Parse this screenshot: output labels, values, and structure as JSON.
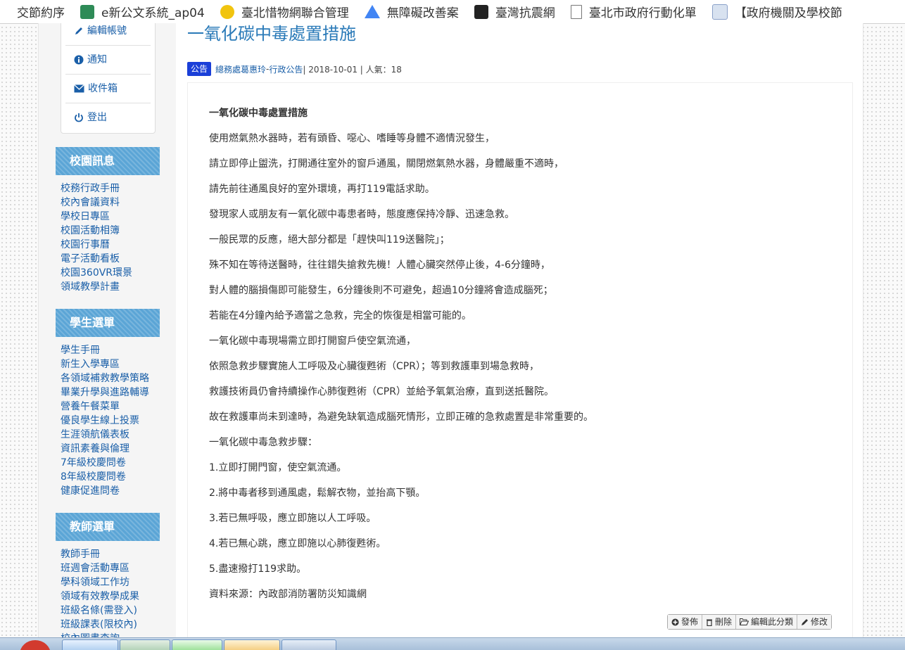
{
  "bookmarks": [
    {
      "label": "交節約序",
      "color": "#c0392b"
    },
    {
      "label": "e新公文系統_ap04",
      "color": "#2e8b57"
    },
    {
      "label": "臺北惜物網聯合管理",
      "color": "#f1c40f"
    },
    {
      "label": "無障礙改善案",
      "color": "#4285f4"
    },
    {
      "label": "臺灣抗震網",
      "color": "#222222"
    },
    {
      "label": "臺北市政府行動化單",
      "color": "#999999"
    },
    {
      "label": "【政府機關及學校節",
      "color": "#5b7bb5"
    }
  ],
  "user_menu": [
    {
      "label": "編輯帳號",
      "icon": "pencil-icon"
    },
    {
      "label": "通知",
      "icon": "info-icon"
    },
    {
      "label": "收件箱",
      "icon": "envelope-icon"
    },
    {
      "label": "登出",
      "icon": "power-icon"
    }
  ],
  "sections": [
    {
      "title": "校園訊息",
      "items": [
        "校務行政手冊",
        "校內會議資料",
        "學校日專區",
        "校園活動相簿",
        "校園行事曆",
        "電子活動看板",
        "校園360VR環景",
        "領域教學計畫"
      ]
    },
    {
      "title": "學生選單",
      "items": [
        "學生手冊",
        "新生入學專區",
        "各領域補救教學策略",
        "畢業升學與進路輔導",
        "營養午餐菜單",
        "優良學生線上投票",
        "生涯領航儀表板",
        "資訊素養與倫理",
        "7年級校慶問卷",
        "8年級校慶問卷",
        "健康促進問卷"
      ]
    },
    {
      "title": "教師選單",
      "items": [
        "教師手冊",
        "班週會活動專區",
        "學科領域工作坊",
        "領域有效教學成果",
        "班級名條(需登入)",
        "班級課表(限校內)",
        "校內圖書查詢"
      ]
    }
  ],
  "article": {
    "title": "一氧化碳中毒處置措施",
    "badge": "公告",
    "author": "總務處葛惠玲",
    "separator1": " - ",
    "category": "行政公告",
    "date_text": " | 2018-10-01 | 人氣：18",
    "paragraphs": [
      "一氧化碳中毒處置措施",
      "使用燃氣熱水器時，若有頭昏、噁心、嗜睡等身體不適情況發生，",
      "請立即停止盥洗，打開通往室外的窗戶通風，關閉燃氣熱水器，身體嚴重不適時，",
      "請先前往通風良好的室外環境，再打119電話求助。",
      "發現家人或朋友有一氧化碳中毒患者時，態度應保持冷靜、迅速急救。",
      "一般民眾的反應，絕大部分都是「趕快叫119送醫院」；",
      "殊不知在等待送醫時，往往錯失搶救先機！人體心臟突然停止後，4-6分鐘時，",
      "對人體的腦損傷即可能發生，6分鐘後則不可避免，超過10分鐘將會造成腦死；",
      "若能在4分鐘內給予適當之急救，完全的恢復是相當可能的。",
      "一氧化碳中毒現場需立即打開窗戶使空氣流通，",
      "依照急救步驟實施人工呼吸及心臟復甦術（CPR）；等到救護車到場急救時，",
      "救護技術員仍會持續操作心肺復甦術（CPR）並給予氧氣治療，直到送抵醫院。",
      "故在救護車尚未到達時，為避免缺氧造成腦死情形，立即正確的急救處置是非常重要的。",
      "一氧化碳中毒急救步驟：",
      "1.立即打開門窗，使空氣流通。",
      "2.將中毒者移到通風處，鬆解衣物，並抬高下顎。",
      "3.若已無呼吸，應立即施以人工呼吸。",
      "4.若已無心跳，應立即施以心肺復甦術。",
      "5.盡速撥打119求助。",
      "資料來源：內政部消防署防災知識網"
    ]
  },
  "actions": [
    {
      "label": "發佈",
      "icon": "plus-circle-icon"
    },
    {
      "label": "刪除",
      "icon": "trash-icon"
    },
    {
      "label": "編輯此分類",
      "icon": "folder-open-icon"
    },
    {
      "label": "修改",
      "icon": "pencil-icon"
    }
  ],
  "colors": {
    "link": "#1a5fa8",
    "title": "#2a7ab8",
    "section_header": "#5ba5d6",
    "badge": "#1a3fd8"
  }
}
